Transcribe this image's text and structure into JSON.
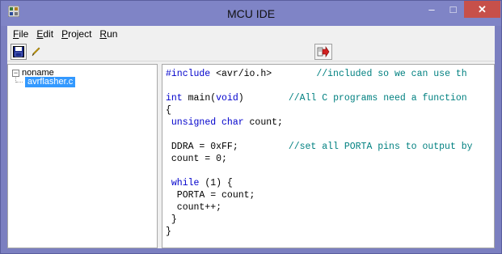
{
  "window": {
    "title": "MCU IDE",
    "minimize_glyph": "–",
    "maximize_glyph": "□",
    "close_glyph": "✕",
    "accent": "#7f84c6",
    "close_color": "#c7504a"
  },
  "menu": {
    "items": [
      {
        "label": "File",
        "accel": "F",
        "rest": "ile"
      },
      {
        "label": "Edit",
        "accel": "E",
        "rest": "dit"
      },
      {
        "label": "Project",
        "accel": "P",
        "rest": "roject"
      },
      {
        "label": "Run",
        "accel": "R",
        "rest": "un"
      }
    ]
  },
  "toolbar": {
    "icons": [
      "save-icon",
      "pencil-icon",
      "run-arrow-icon"
    ]
  },
  "tree": {
    "root_label": "noname",
    "expander_glyph": "−",
    "selected_file": "avrflasher.c",
    "selection_color": "#3399ff"
  },
  "editor": {
    "lines": [
      {
        "parts": [
          {
            "k": "kw",
            "t": "#include"
          },
          {
            "k": "",
            "t": " <avr/io.h>        "
          },
          {
            "k": "cm",
            "t": "//included so we can use th"
          }
        ]
      },
      {
        "parts": [
          {
            "k": "",
            "t": " "
          }
        ]
      },
      {
        "parts": [
          {
            "k": "kw",
            "t": "int"
          },
          {
            "k": "",
            "t": " main("
          },
          {
            "k": "kw",
            "t": "void"
          },
          {
            "k": "",
            "t": ")        "
          },
          {
            "k": "cm",
            "t": "//All C programs need a function"
          }
        ]
      },
      {
        "parts": [
          {
            "k": "",
            "t": "{"
          }
        ]
      },
      {
        "parts": [
          {
            "k": "",
            "t": " "
          },
          {
            "k": "kw",
            "t": "unsigned char"
          },
          {
            "k": "",
            "t": " count;"
          }
        ]
      },
      {
        "parts": [
          {
            "k": "",
            "t": " "
          }
        ]
      },
      {
        "parts": [
          {
            "k": "",
            "t": " DDRA = 0xFF;         "
          },
          {
            "k": "cm",
            "t": "//set all PORTA pins to output by"
          }
        ]
      },
      {
        "parts": [
          {
            "k": "",
            "t": " count = 0;"
          }
        ]
      },
      {
        "parts": [
          {
            "k": "",
            "t": " "
          }
        ]
      },
      {
        "parts": [
          {
            "k": "",
            "t": " "
          },
          {
            "k": "kw",
            "t": "while"
          },
          {
            "k": "",
            "t": " (1) {"
          }
        ]
      },
      {
        "parts": [
          {
            "k": "",
            "t": "  PORTA = count;"
          }
        ]
      },
      {
        "parts": [
          {
            "k": "",
            "t": "  count++;"
          }
        ]
      },
      {
        "parts": [
          {
            "k": "",
            "t": " }"
          }
        ]
      },
      {
        "parts": [
          {
            "k": "",
            "t": "}"
          }
        ]
      }
    ],
    "keyword_color": "#0000cc",
    "comment_color": "#008080"
  }
}
